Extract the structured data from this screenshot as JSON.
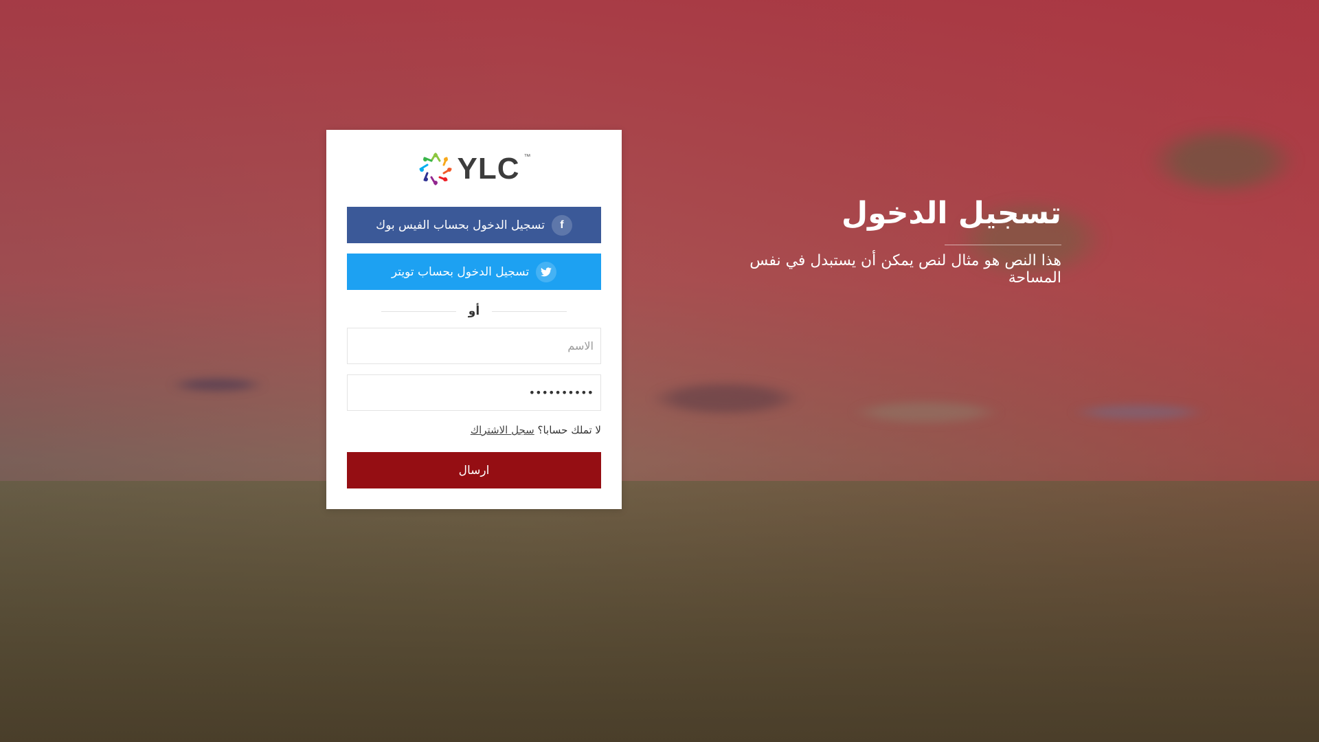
{
  "brand": {
    "logo_text": "YLC",
    "trademark": "™"
  },
  "login_card": {
    "facebook_button_label": "تسجيل الدخول بحساب الفيس بوك",
    "facebook_icon": "facebook-icon",
    "twitter_button_label": "تسجيل الدخول بحساب تويتر",
    "twitter_icon": "twitter-icon",
    "divider_text": "أو",
    "name_placeholder": "الاسم",
    "password_value": "**********",
    "signup_prompt": "لا تملك حسابا؟",
    "signup_link": "سجل الاشتراك",
    "submit_label": "ارسال"
  },
  "hero": {
    "title": "تسجيل الدخول",
    "description": "هذا النص هو مثال لنص يمكن أن يستبدل في نفس المساحة"
  },
  "colors": {
    "facebook": "#3b5998",
    "twitter": "#1da1f2",
    "submit": "#950e13",
    "overlay": "#a83440"
  }
}
